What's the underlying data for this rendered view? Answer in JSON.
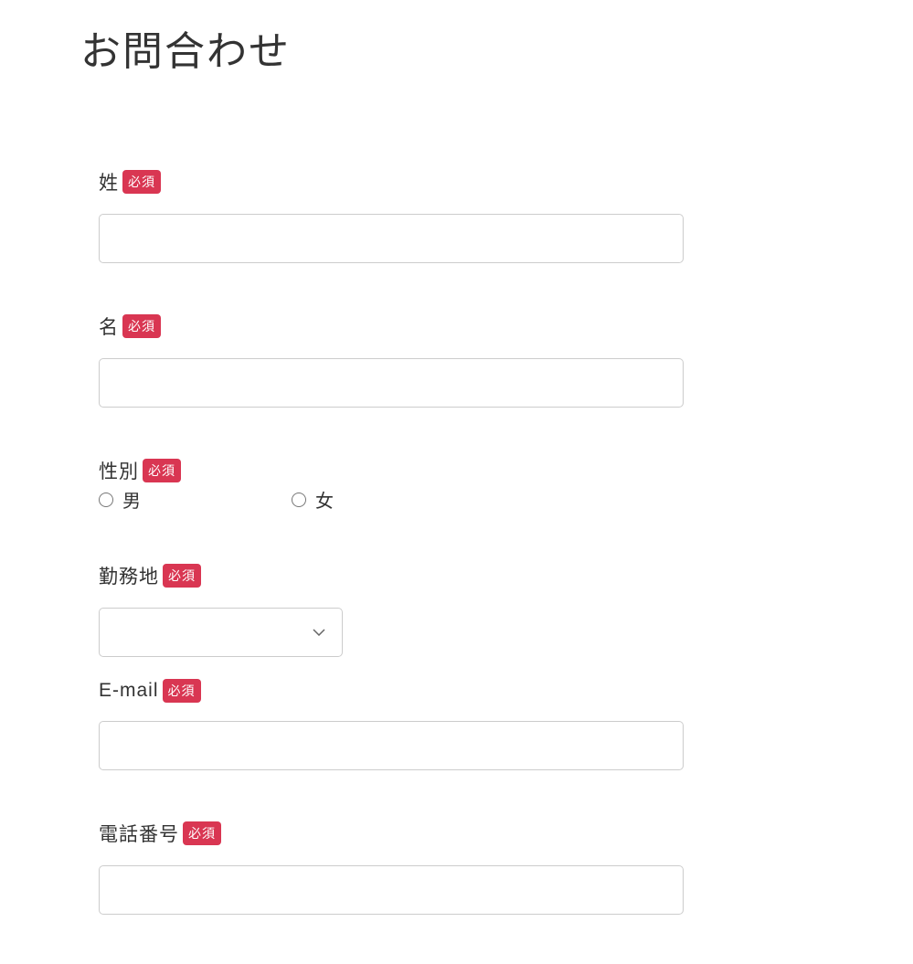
{
  "page": {
    "title": "お問合わせ"
  },
  "form": {
    "required_label": "必須",
    "fields": {
      "last_name": {
        "label": "姓",
        "value": ""
      },
      "first_name": {
        "label": "名",
        "value": ""
      },
      "gender": {
        "label": "性別",
        "options": {
          "male": "男",
          "female": "女"
        },
        "value": ""
      },
      "workplace": {
        "label": "勤務地",
        "value": ""
      },
      "email": {
        "label": "E-mail",
        "value": ""
      },
      "phone": {
        "label": "電話番号",
        "value": ""
      }
    }
  }
}
